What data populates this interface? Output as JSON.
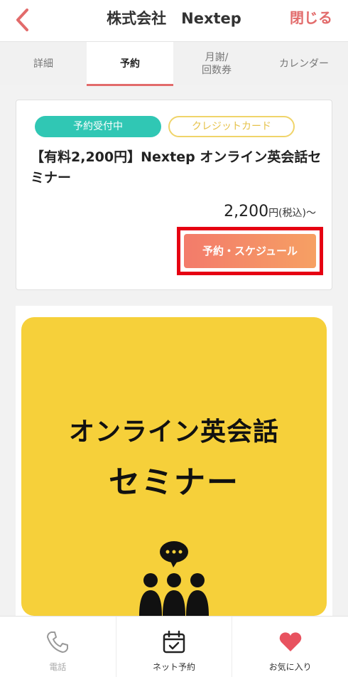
{
  "header": {
    "title": "株式会社　Nextep",
    "close_label": "閉じる"
  },
  "tabs": [
    {
      "label": "詳細"
    },
    {
      "label": "予約"
    },
    {
      "label": "月謝/\n回数券"
    },
    {
      "label": "カレンダー"
    }
  ],
  "card": {
    "status_badge": "予約受付中",
    "payment_badge": "クレジットカード",
    "title": "【有料2,200円】Nextep オンライン英会話セミナー",
    "price": "2,200",
    "price_unit": "円(税込)〜",
    "reserve_label": "予約・スケジュール"
  },
  "hero": {
    "line1": "オンライン英会話",
    "line2": "セミナー"
  },
  "bottom_nav": [
    {
      "label": "電話",
      "icon": "phone-icon"
    },
    {
      "label": "ネット予約",
      "icon": "calendar-check-icon"
    },
    {
      "label": "お気に入り",
      "icon": "heart-icon"
    }
  ],
  "colors": {
    "accent": "#e26b6b",
    "status_green": "#30c7b4",
    "badge_yellow": "#f0d46a",
    "hero_yellow": "#f6d03a",
    "highlight_red": "#e60012"
  }
}
